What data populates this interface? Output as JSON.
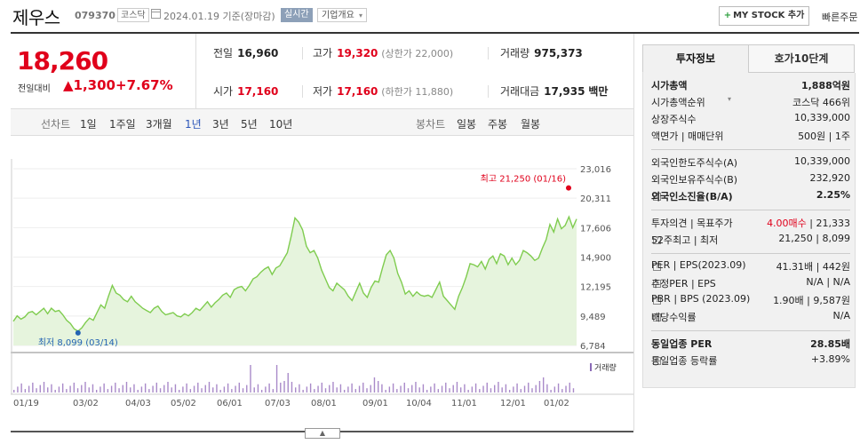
{
  "header": {
    "name": "제우스",
    "code": "079370",
    "market": "코스닥",
    "date": "2024.01.19",
    "basis": "기준(장마감)",
    "realtime": "실시간",
    "corp_info": "기업개요",
    "my_stock": "MY STOCK 추가",
    "quick_order": "빠른주문"
  },
  "price": {
    "current": "18,260",
    "change_label": "전일대비",
    "change": "1,300",
    "change_pct": "+7.67%"
  },
  "stats": {
    "prev_label": "전일",
    "prev": "16,960",
    "high_label": "고가",
    "high": "19,320",
    "upper_limit": "(상한가 22,000)",
    "volume_label": "거래량",
    "volume": "975,373",
    "open_label": "시가",
    "open": "17,160",
    "low_label": "저가",
    "low": "17,160",
    "lower_limit": "(하한가 11,880)",
    "amount_label": "거래대금",
    "amount": "17,935",
    "amount_unit": "백만"
  },
  "periods": {
    "line_label": "선차트",
    "line": [
      "1일",
      "1주일",
      "3개월",
      "1년",
      "3년",
      "5년",
      "10년"
    ],
    "candle_label": "봉차트",
    "candle": [
      "일봉",
      "주봉",
      "월봉"
    ],
    "active": "1년"
  },
  "chart_data": {
    "type": "area",
    "y_ticks": [
      "23,016",
      "20,311",
      "17,606",
      "14,900",
      "12,195",
      "9,489",
      "6,784"
    ],
    "ylim": [
      6784,
      23016
    ],
    "x_ticks": [
      "01/19",
      "03/02",
      "04/03",
      "05/02",
      "06/01",
      "07/03",
      "08/01",
      "09/01",
      "10/04",
      "11/01",
      "12/01",
      "01/02"
    ],
    "max_label": "최고 21,250 (01/16)",
    "min_label": "최저 8,099 (03/14)",
    "volume_legend": "거래량",
    "series": [
      {
        "values": [
          9000,
          9500,
          9200,
          9400,
          9800,
          9900,
          9600,
          9900,
          10200,
          9700,
          10200,
          9900,
          10000,
          9600,
          9100,
          8800,
          8300,
          8099,
          8400,
          8900,
          9300,
          9100,
          9800,
          10500,
          10200,
          11300,
          12300,
          11600,
          11400,
          11000,
          10800,
          11300,
          10800,
          10500,
          10200,
          10000,
          9800,
          10200,
          10400,
          9900,
          9600,
          9700,
          9800,
          9500,
          9400,
          9700,
          9500,
          9800,
          10200,
          10000,
          10400,
          10800,
          10300,
          10700,
          11000,
          11400,
          11600,
          11200,
          11900,
          12100,
          12200,
          11800,
          12300,
          12900,
          13100,
          13500,
          13800,
          14000,
          13300,
          13900,
          14100,
          14700,
          15300,
          16800,
          18500,
          18100,
          17400,
          15900,
          15300,
          15500,
          14800,
          13700,
          12900,
          12100,
          11800,
          12500,
          12200,
          11900,
          11300,
          10900,
          11700,
          12500,
          11600,
          11200,
          12100,
          12700,
          12600,
          13900,
          15100,
          15500,
          14800,
          13400,
          12600,
          11500,
          11800,
          11300,
          11700,
          11400,
          11300,
          11400,
          11200,
          11900,
          12600,
          11300,
          10900,
          10500,
          10100,
          11300,
          12100,
          13100,
          14300,
          14200,
          14000,
          14500,
          13800,
          14700,
          15000,
          14300,
          15200,
          15000,
          14200,
          14800,
          14200,
          14600,
          15500,
          15300,
          15000,
          14600,
          14800,
          15700,
          16500,
          17900,
          17200,
          18400,
          17500,
          17800,
          18600,
          17600,
          18400
        ]
      }
    ]
  }
}
